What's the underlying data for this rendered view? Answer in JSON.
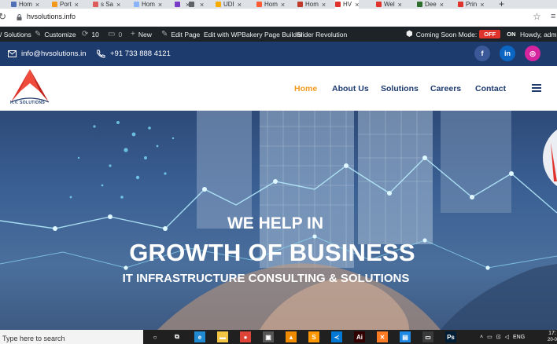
{
  "browser": {
    "tabs": [
      {
        "label": "Hom",
        "color": "#4f6fb7"
      },
      {
        "label": "Port",
        "color": "#f39a1e"
      },
      {
        "label": "s Sa",
        "color": "#e05b5b"
      },
      {
        "label": "Hom",
        "color": "#8ab4f8"
      },
      {
        "label": "",
        "color": "#7a3cc8"
      },
      {
        "label": "",
        "color": "#5f6368"
      },
      {
        "label": "UDI",
        "color": "#f9ab00"
      },
      {
        "label": "Hom",
        "color": "#ff5a36"
      },
      {
        "label": "Hom",
        "color": "#c0392b"
      },
      {
        "label": "HV",
        "color": "#e0332c"
      },
      {
        "label": "Wel",
        "color": "#e0332c"
      },
      {
        "label": "Dee",
        "color": "#2d6e2d"
      },
      {
        "label": "Prin",
        "color": "#e0332c"
      }
    ],
    "new_tab": "+",
    "url": "hvsolutions.info"
  },
  "admin_bar": {
    "site": "/ Solutions",
    "customize": "Customize",
    "updates": "10",
    "comments": "0",
    "new": "New",
    "edit_page": "Edit Page",
    "wpbakery": "Edit with WPBakery Page Builder",
    "slider": "Slider Revolution",
    "coming_soon": "Coming Soon Mode:",
    "off": "OFF",
    "on": "ON",
    "howdy": "Howdy, admin"
  },
  "contact": {
    "email": "info@hvsolutions.in",
    "phone": "+91 733 888 4121",
    "social": [
      {
        "icon": "facebook-icon",
        "glyph": "f",
        "color": "#3b5998"
      },
      {
        "icon": "linkedin-icon",
        "glyph": "in",
        "color": "#0a66c2"
      },
      {
        "icon": "instagram-icon",
        "glyph": "◎",
        "color": "#d6249f"
      }
    ]
  },
  "header": {
    "logo_text": "H.V. SOLUTIONS",
    "nav": [
      "Home",
      "About Us",
      "Solutions",
      "Careers",
      "Contact"
    ],
    "active_nav": "Home",
    "accent": "#f39a1e",
    "nav_color": "#1e3b6e"
  },
  "hero": {
    "line1": "WE HELP IN",
    "line2": "GROWTH OF BUSINESS",
    "line3": "IT INFRASTRUCTURE CONSULTING & SOLUTIONS"
  },
  "taskbar": {
    "search_placeholder": "Type here to search",
    "apps": [
      {
        "icon": "cortana-icon",
        "glyph": "○",
        "color": "#202020"
      },
      {
        "icon": "task-view-icon",
        "glyph": "⧉",
        "color": "#202020"
      },
      {
        "icon": "edge-icon",
        "glyph": "e",
        "color": "#1f8ad2"
      },
      {
        "icon": "file-explorer-icon",
        "glyph": "▬",
        "color": "#f4c542"
      },
      {
        "icon": "chrome-icon",
        "glyph": "●",
        "color": "#db4437"
      },
      {
        "icon": "store-icon",
        "glyph": "▣",
        "color": "#555"
      },
      {
        "icon": "vlc-icon",
        "glyph": "▲",
        "color": "#f08a00"
      },
      {
        "icon": "sublime-icon",
        "glyph": "S",
        "color": "#ff9800"
      },
      {
        "icon": "vscode-icon",
        "glyph": "≺",
        "color": "#0078d4"
      },
      {
        "icon": "illustrator-icon",
        "glyph": "Ai",
        "color": "#330000"
      },
      {
        "icon": "xampp-icon",
        "glyph": "✕",
        "color": "#fb7a24"
      },
      {
        "icon": "notepad-icon",
        "glyph": "▤",
        "color": "#1e88e5"
      },
      {
        "icon": "photos-icon",
        "glyph": "▭",
        "color": "#3a3a3a"
      },
      {
        "icon": "photoshop-icon",
        "glyph": "Ps",
        "color": "#001e36"
      }
    ],
    "language": "ENG",
    "time": "17:",
    "date": "20-0"
  }
}
